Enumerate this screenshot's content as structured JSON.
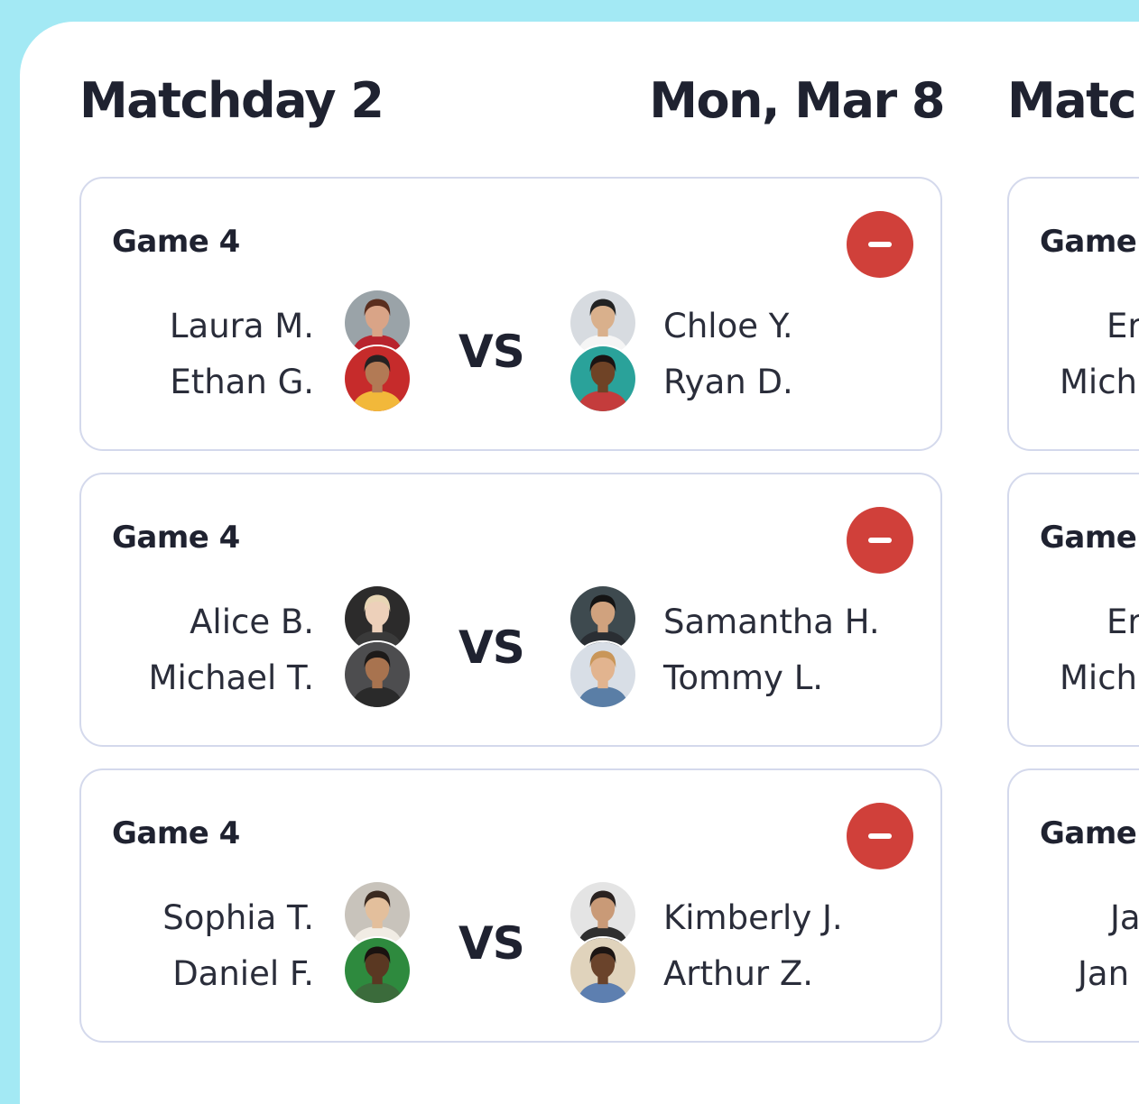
{
  "columns": [
    {
      "title": "Matchday 2",
      "date": "Mon, Mar 8",
      "games": [
        {
          "label": "Game 4",
          "team_a": [
            {
              "name": "Laura M.",
              "avatar": {
                "bg": "#9aa3a8",
                "skin": "#d9a487",
                "hair": "#5a2e1e",
                "shirt": "#b8242e"
              }
            },
            {
              "name": "Ethan G.",
              "avatar": {
                "bg": "#c62b2b",
                "skin": "#b27a55",
                "hair": "#262222",
                "shirt": "#f2b83a"
              }
            }
          ],
          "team_b": [
            {
              "name": "Chloe Y.",
              "avatar": {
                "bg": "#d7dbe0",
                "skin": "#d9b08c",
                "hair": "#232323",
                "shirt": "#f5f5f5"
              }
            },
            {
              "name": "Ryan D.",
              "avatar": {
                "bg": "#2aa29a",
                "skin": "#6f4326",
                "hair": "#1b1413",
                "shirt": "#c43c3c"
              }
            }
          ]
        },
        {
          "label": "Game 4",
          "team_a": [
            {
              "name": "Alice B.",
              "avatar": {
                "bg": "#2c2b2b",
                "skin": "#edd0ba",
                "hair": "#e8d6b5",
                "shirt": "#3a3a3a"
              }
            },
            {
              "name": "Michael T.",
              "avatar": {
                "bg": "#4d4d4f",
                "skin": "#a8734f",
                "hair": "#1d1a19",
                "shirt": "#2a2a2a"
              }
            }
          ],
          "team_b": [
            {
              "name": "Samantha H.",
              "avatar": {
                "bg": "#3e4a4f",
                "skin": "#d0a27e",
                "hair": "#141414",
                "shirt": "#2a2e33"
              }
            },
            {
              "name": "Tommy L.",
              "avatar": {
                "bg": "#d8dee6",
                "skin": "#e2b48f",
                "hair": "#c99659",
                "shirt": "#5a7ea6"
              }
            }
          ]
        },
        {
          "label": "Game 4",
          "team_a": [
            {
              "name": "Sophia T.",
              "avatar": {
                "bg": "#c8c3bb",
                "skin": "#e3bf9c",
                "hair": "#3b2a20",
                "shirt": "#f1ece4"
              }
            },
            {
              "name": "Daniel F.",
              "avatar": {
                "bg": "#2e8a3e",
                "skin": "#5a3822",
                "hair": "#1a1210",
                "shirt": "#3b6b3b"
              }
            }
          ],
          "team_b": [
            {
              "name": "Kimberly J.",
              "avatar": {
                "bg": "#e4e4e4",
                "skin": "#c99a77",
                "hair": "#2a2220",
                "shirt": "#2f2f2f"
              }
            },
            {
              "name": "Arthur Z.",
              "avatar": {
                "bg": "#e0d3bc",
                "skin": "#6a432b",
                "hair": "#1c1513",
                "shirt": "#5d7fb0"
              }
            }
          ]
        }
      ]
    },
    {
      "title": "Matc",
      "games": [
        {
          "label": "Game",
          "team_a": [
            {
              "name": "Er"
            },
            {
              "name": "Mich"
            }
          ]
        },
        {
          "label": "Game",
          "team_a": [
            {
              "name": "Er"
            },
            {
              "name": "Mich"
            }
          ]
        },
        {
          "label": "Game",
          "team_a": [
            {
              "name": "Ja"
            },
            {
              "name": "Jan"
            }
          ]
        }
      ]
    }
  ],
  "vs_label": "VS",
  "icons": {
    "remove": "minus-circle-icon"
  },
  "colors": {
    "remove_button": "#d0403a",
    "background_accent": "#a3e9f4",
    "card_border": "#d4d9ec",
    "text_primary": "#1f2230"
  }
}
